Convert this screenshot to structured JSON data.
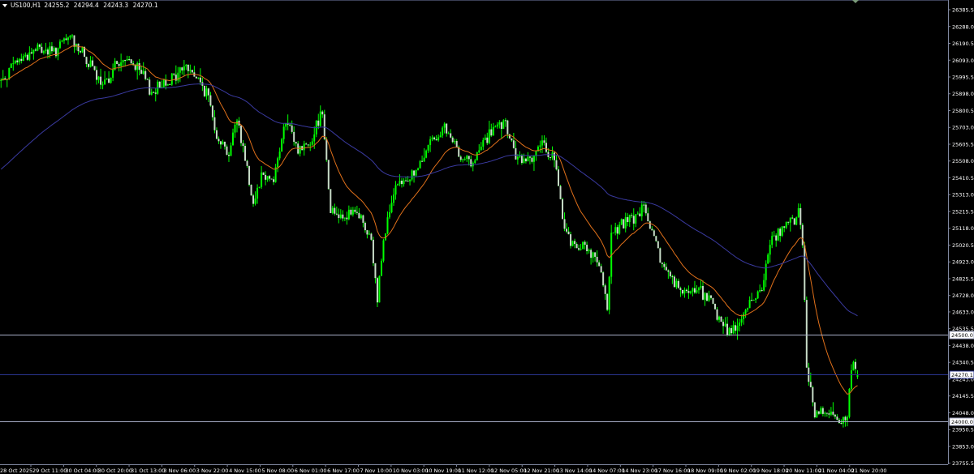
{
  "header": {
    "symbol": "US100,H1",
    "open": "24255.2",
    "high": "24294.4",
    "low": "24243.3",
    "close": "24270.1"
  },
  "colors": {
    "background": "#000000",
    "bull": "#00ff00",
    "bear": "#c8dcc8",
    "axis_text": "#ffffff",
    "grid_border": "#8088a0",
    "ma_fast": "#e0701a",
    "ma_slow": "#3a3aa0",
    "level_line": "#a8aec8",
    "level_line_current": "#2a3590"
  },
  "chart_data": {
    "type": "candlestick",
    "title": "US100,H1",
    "ylim": [
      23749.4,
      26441.9
    ],
    "bar_count_visible": 466,
    "y_tick_labels": [
      "26385.5",
      "26288.0",
      "26190.5",
      "26093.0",
      "25995.5",
      "25898.0",
      "25800.5",
      "25703.0",
      "25605.5",
      "25508.0",
      "25410.5",
      "25313.0",
      "25215.5",
      "25118.0",
      "25020.5",
      "24923.0",
      "24825.5",
      "24728.0",
      "24633.0",
      "24535.5",
      "24438.0",
      "24340.5",
      "24243.0",
      "24145.5",
      "24048.0",
      "23950.5",
      "23853.0",
      "23755.5"
    ],
    "x_tick_labels": [
      "28 Oct 2025",
      "29 Oct 11:00",
      "30 Oct 04:00",
      "30 Oct 20:00",
      "31 Oct 13:00",
      "3 Nov 06:00",
      "3 Nov 22:00",
      "4 Nov 15:00",
      "5 Nov 08:00",
      "6 Nov 01:00",
      "6 Nov 17:00",
      "7 Nov 10:00",
      "10 Nov 03:00",
      "10 Nov 19:00",
      "11 Nov 12:00",
      "12 Nov 05:00",
      "12 Nov 21:00",
      "13 Nov 14:00",
      "14 Nov 07:00",
      "14 Nov 23:00",
      "17 Nov 16:00",
      "18 Nov 09:00",
      "19 Nov 02:00",
      "19 Nov 18:00",
      "20 Nov 11:00",
      "21 Nov 04:00",
      "21 Nov 20:00"
    ],
    "price_path": [
      [
        0,
        25972
      ],
      [
        8,
        26089
      ],
      [
        18,
        26160
      ],
      [
        26,
        26136
      ],
      [
        34,
        26230
      ],
      [
        40,
        26136
      ],
      [
        46,
        26019
      ],
      [
        50,
        25925
      ],
      [
        56,
        26066
      ],
      [
        64,
        26089
      ],
      [
        70,
        25995
      ],
      [
        74,
        25902
      ],
      [
        80,
        25972
      ],
      [
        86,
        25995
      ],
      [
        90,
        26066
      ],
      [
        96,
        25995
      ],
      [
        102,
        25878
      ],
      [
        106,
        25667
      ],
      [
        112,
        25549
      ],
      [
        116,
        25760
      ],
      [
        120,
        25526
      ],
      [
        124,
        25267
      ],
      [
        128,
        25432
      ],
      [
        134,
        25408
      ],
      [
        140,
        25737
      ],
      [
        146,
        25573
      ],
      [
        152,
        25620
      ],
      [
        158,
        25808
      ],
      [
        162,
        25220
      ],
      [
        168,
        25197
      ],
      [
        176,
        25197
      ],
      [
        182,
        25032
      ],
      [
        185,
        24703
      ],
      [
        188,
        25079
      ],
      [
        194,
        25338
      ],
      [
        200,
        25408
      ],
      [
        206,
        25479
      ],
      [
        212,
        25643
      ],
      [
        218,
        25690
      ],
      [
        224,
        25573
      ],
      [
        232,
        25479
      ],
      [
        236,
        25596
      ],
      [
        242,
        25690
      ],
      [
        248,
        25714
      ],
      [
        254,
        25502
      ],
      [
        260,
        25526
      ],
      [
        266,
        25596
      ],
      [
        272,
        25526
      ],
      [
        276,
        25173
      ],
      [
        280,
        25032
      ],
      [
        288,
        25009
      ],
      [
        294,
        24891
      ],
      [
        298,
        24656
      ],
      [
        300,
        25079
      ],
      [
        306,
        25150
      ],
      [
        312,
        25173
      ],
      [
        316,
        25244
      ],
      [
        320,
        25079
      ],
      [
        324,
        24938
      ],
      [
        330,
        24821
      ],
      [
        336,
        24727
      ],
      [
        342,
        24774
      ],
      [
        348,
        24703
      ],
      [
        352,
        24609
      ],
      [
        358,
        24515
      ],
      [
        364,
        24586
      ],
      [
        370,
        24727
      ],
      [
        374,
        24750
      ],
      [
        378,
        25056
      ],
      [
        384,
        25103
      ],
      [
        390,
        25173
      ],
      [
        392,
        25220
      ],
      [
        394,
        25032
      ],
      [
        396,
        24327
      ],
      [
        400,
        24045
      ],
      [
        406,
        24069
      ],
      [
        412,
        23998
      ],
      [
        416,
        24045
      ],
      [
        419,
        24374
      ],
      [
        421,
        24270.1
      ]
    ],
    "last_bar": {
      "open": 24255.2,
      "high": 24294.4,
      "low": 24243.3,
      "close": 24270.1
    },
    "indicators": [
      {
        "name": "MA fast",
        "type": "EMA",
        "period": 20,
        "color_key": "ma_fast"
      },
      {
        "name": "MA slow",
        "type": "EMA",
        "period": 100,
        "seed": 25450,
        "color_key": "ma_slow"
      }
    ],
    "horizontal_levels": [
      {
        "price": 24500.0,
        "label": "24500.0",
        "color_key": "level_line"
      },
      {
        "price": 24270.1,
        "label": "24270.1",
        "color_key": "level_line_current"
      },
      {
        "price": 24000.0,
        "label": "24000.0",
        "color_key": "level_line"
      }
    ]
  }
}
